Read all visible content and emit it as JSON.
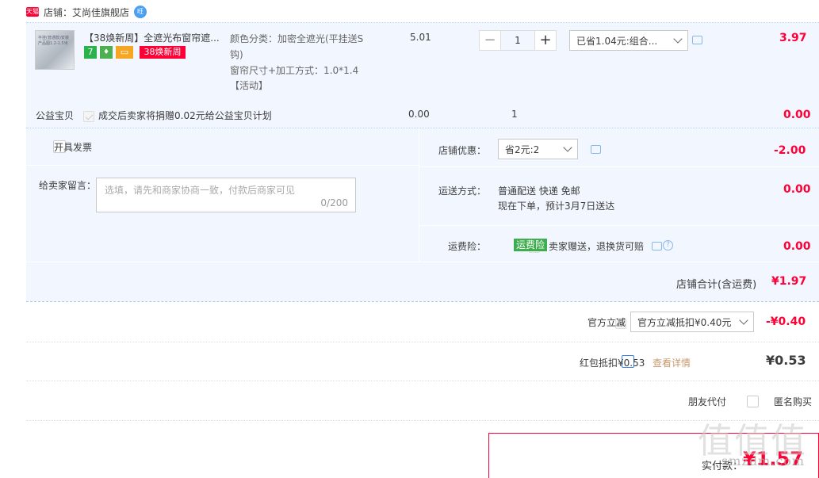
{
  "shop": {
    "tmall_badge": "天猫",
    "label": "店铺：艾尚佳旗舰店",
    "ww_badge": "旺"
  },
  "item": {
    "thumb_text": "平挂(普通款)安装产品图1.2-1.5米",
    "title": "【38焕新周】全遮光布窗帘遮...",
    "badge_seven": "7",
    "badge_38": "38焕新周",
    "attr1": "颜色分类：加密全遮光(平挂送S钩)",
    "attr2": "窗帘尺寸+加工方式：1.0*1.4",
    "activity": "【活动】",
    "unit_price": "5.01",
    "qty": "1",
    "promo_select": "已省1.04元:组合...",
    "subtotal": "3.97"
  },
  "charity": {
    "label": "公益宝贝",
    "text": "成交后卖家将捐赠0.02元给公益宝贝计划",
    "price": "0.00",
    "qty": "1",
    "subtotal": "0.00"
  },
  "invoice": {
    "label": "开具发票"
  },
  "shop_discount": {
    "label": "店铺优惠：",
    "select": "省2元:2",
    "amount": "-2.00"
  },
  "message": {
    "label": "给卖家留言：",
    "placeholder": "选填，请先和商家协商一致，付款后商家可见",
    "counter": "0/200"
  },
  "shipping": {
    "label": "运送方式：",
    "method": "普通配送 快递 免邮",
    "eta": "现在下单，预计3月7日送达",
    "amount": "0.00"
  },
  "insurance": {
    "label": "运费险：",
    "tag": "运费险",
    "text": "卖家赠送，退换货可赔",
    "amount": "0.00"
  },
  "shop_total": {
    "label": "店铺合计(含运费)",
    "amount": "¥1.97"
  },
  "official": {
    "label": "官方立减",
    "select": "官方立减抵扣¥0.40元",
    "amount": "-¥0.40"
  },
  "redpacket": {
    "label": "红包抵扣¥0.53",
    "link": "查看详情",
    "amount": "¥0.53"
  },
  "options": {
    "friend_pay": "朋友代付",
    "anonymous": "匿名购买"
  },
  "pay": {
    "label": "实付款：",
    "amount": "¥1.57"
  },
  "watermark": "值值值",
  "watermark_url": "smzdm.com",
  "colors": {
    "price_red": "#ff0036",
    "bluebg": "#f2f7ff",
    "accent_blue": "#3c7ee6"
  }
}
